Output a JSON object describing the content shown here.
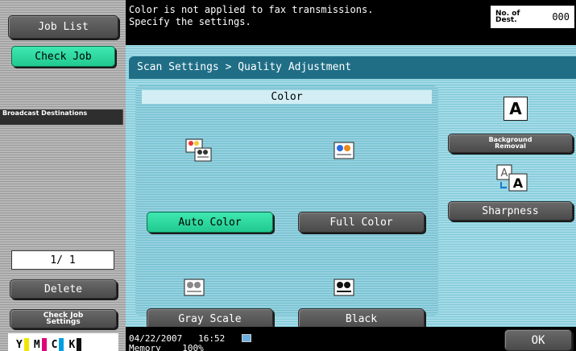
{
  "sidebar": {
    "job_list": "Job List",
    "check_job": "Check Job",
    "broadcast_destinations": "Broadcast Destinations",
    "page_counter": "1/ 1",
    "delete": "Delete",
    "check_job_settings": "Check Job Settings",
    "toner": [
      {
        "letter": "Y",
        "color": "#f2e600"
      },
      {
        "letter": "M",
        "color": "#e0007a"
      },
      {
        "letter": "C",
        "color": "#00a0e0"
      },
      {
        "letter": "K",
        "color": "#111111"
      }
    ]
  },
  "header": {
    "message_line1": "Color is not applied to fax transmissions.",
    "message_line2": "Specify the settings.",
    "no_of_dest_label": "No. of Dest.",
    "no_of_dest_value": "000"
  },
  "main": {
    "breadcrumb": "Scan Settings > Quality Adjustment",
    "color_section_title": "Color",
    "options": [
      {
        "label": "Auto Color",
        "selected": true,
        "icon": "auto-color-icon"
      },
      {
        "label": "Full Color",
        "selected": false,
        "icon": "full-color-icon"
      },
      {
        "label": "Gray Scale",
        "selected": false,
        "icon": "gray-scale-icon"
      },
      {
        "label": "Black",
        "selected": false,
        "icon": "black-icon"
      }
    ],
    "background_removal": "Background Removal",
    "sharpness": "Sharpness"
  },
  "status": {
    "date": "04/22/2007",
    "time": "16:52",
    "memory_label": "Memory",
    "memory_value": "100%",
    "ok": "OK"
  },
  "colors": {
    "selected_green": "#2fdca0",
    "header_teal": "#1f6e86",
    "panel_light_blue": "#a4dbe6"
  }
}
